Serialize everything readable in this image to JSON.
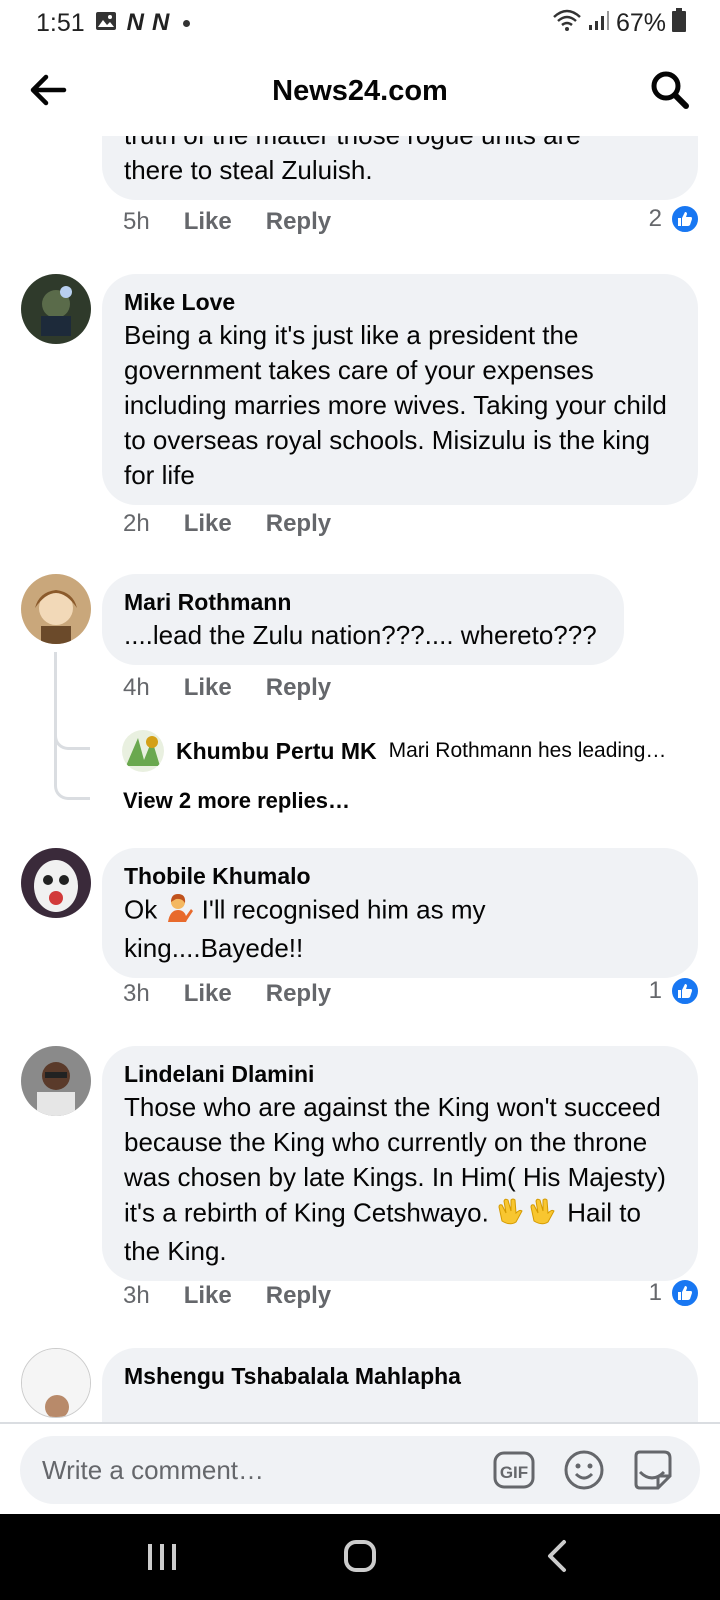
{
  "status_bar": {
    "time": "1:51",
    "battery": "67%"
  },
  "header": {
    "title": "News24.com"
  },
  "comments": [
    {
      "text_top": "truth of the matter  those rogue units are",
      "text": "there to steal Zuluish.",
      "time": "5h",
      "like": "Like",
      "reply": "Reply",
      "reactions": "2"
    },
    {
      "name": "Mike Love",
      "text": "Being a king it's just like a president the government takes care of your expenses including marries more wives. Taking your child to overseas royal schools. Misizulu is the king for life",
      "time": "2h",
      "like": "Like",
      "reply": "Reply"
    },
    {
      "name": "Mari Rothmann",
      "text": "....lead the Zulu nation???.... whereto???",
      "time": "4h",
      "like": "Like",
      "reply": "Reply",
      "reply_preview": {
        "name": "Khumbu Pertu MK",
        "snippet": "Mari Rothmann hes leading…"
      },
      "more_replies": "View 2 more replies…"
    },
    {
      "name": "Thobile Khumalo",
      "text_a": "Ok ",
      "text_b": " I'll recognised him as my",
      "text_c": "king....Bayede!!",
      "time": "3h",
      "like": "Like",
      "reply": "Reply",
      "reactions": "1"
    },
    {
      "name": "Lindelani Dlamini",
      "text_a": "Those who are against the King won't succeed because the King who currently on the throne was chosen by late Kings. In Him( His Majesty) it's a rebirth of King Cetshwayo. ",
      "text_b": " Hail to the King.",
      "time": "3h",
      "like": "Like",
      "reply": "Reply",
      "reactions": "1"
    },
    {
      "name": "Mshengu Tshabalala Mahlapha"
    }
  ],
  "composer": {
    "placeholder": "Write a comment…",
    "gif_label": "GIF"
  },
  "colors": {
    "accent": "#1877f2",
    "bubble": "#f0f2f5",
    "meta": "#65676b"
  }
}
